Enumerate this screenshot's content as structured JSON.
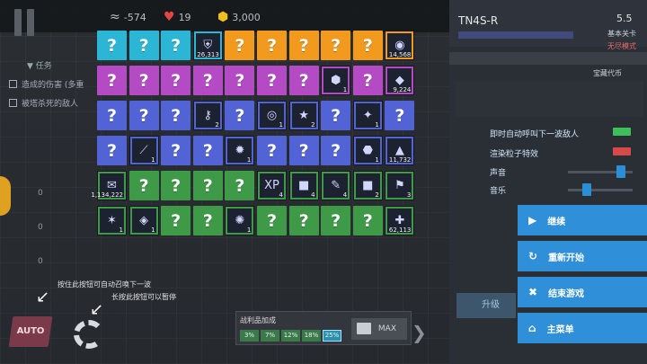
{
  "topbar": {
    "resource1": "-574",
    "hearts": "19",
    "coins": "3,000"
  },
  "mission": {
    "title": "任务",
    "items": [
      "造成的伤害 (多重",
      "被塔杀死的敌人"
    ]
  },
  "slots": [
    {
      "count": "0"
    },
    {
      "count": "0"
    },
    {
      "count": "0"
    }
  ],
  "hints": {
    "auto_summon": "按住此按钮可自动召唤下一波",
    "long_pause": "长按此按钮可以暂停"
  },
  "auto_label": "AUTO",
  "loot": {
    "title": "战利品加成",
    "percentages": [
      "3%",
      "7%",
      "12%",
      "18%",
      "25%"
    ],
    "active_index": 4,
    "max_label": "MAX"
  },
  "grid": {
    "rows": [
      {
        "color": "#2bb6d6",
        "cells": [
          {
            "t": "q"
          },
          {
            "t": "q"
          },
          {
            "t": "q"
          },
          {
            "t": "i",
            "sym": "⛨",
            "cnt": "26,313"
          },
          {
            "t": "q",
            "c": "#f29a1e"
          },
          {
            "t": "q",
            "c": "#f29a1e"
          },
          {
            "t": "q",
            "c": "#f29a1e"
          },
          {
            "t": "q",
            "c": "#f29a1e"
          },
          {
            "t": "q",
            "c": "#f29a1e"
          },
          {
            "t": "i",
            "sym": "◉",
            "cnt": "14,568",
            "c": "#f29a1e"
          }
        ]
      },
      {
        "color": "#b44bc4",
        "cells": [
          {
            "t": "q"
          },
          {
            "t": "q"
          },
          {
            "t": "q"
          },
          {
            "t": "q"
          },
          {
            "t": "q"
          },
          {
            "t": "q"
          },
          {
            "t": "q"
          },
          {
            "t": "i",
            "sym": "⬢",
            "cnt": "1"
          },
          {
            "t": "q"
          },
          {
            "t": "i",
            "sym": "◆",
            "cnt": "9,224"
          }
        ]
      },
      {
        "color": "#5263d6",
        "cells": [
          {
            "t": "q"
          },
          {
            "t": "q"
          },
          {
            "t": "q"
          },
          {
            "t": "i",
            "sym": "⚷",
            "cnt": "2"
          },
          {
            "t": "q"
          },
          {
            "t": "i",
            "sym": "◎",
            "cnt": "1"
          },
          {
            "t": "i",
            "sym": "★",
            "cnt": "2"
          },
          {
            "t": "q"
          },
          {
            "t": "i",
            "sym": "✦",
            "cnt": "1"
          },
          {
            "t": "q"
          }
        ]
      },
      {
        "color": "#5263d6",
        "cells": [
          {
            "t": "q"
          },
          {
            "t": "i",
            "sym": "⟋",
            "cnt": "1"
          },
          {
            "t": "q"
          },
          {
            "t": "q"
          },
          {
            "t": "i",
            "sym": "✹",
            "cnt": "1"
          },
          {
            "t": "q"
          },
          {
            "t": "q"
          },
          {
            "t": "q"
          },
          {
            "t": "i",
            "sym": "⬣",
            "cnt": "1"
          },
          {
            "t": "i",
            "sym": "▲",
            "cnt": "11,732"
          }
        ]
      },
      {
        "color": "#3f9a48",
        "cells": [
          {
            "t": "i",
            "sym": "✉",
            "cnt": "1,134,222"
          },
          {
            "t": "q"
          },
          {
            "t": "q"
          },
          {
            "t": "q"
          },
          {
            "t": "q"
          },
          {
            "t": "i",
            "sym": "XP",
            "cnt": "4"
          },
          {
            "t": "i",
            "sym": "■",
            "cnt": "4"
          },
          {
            "t": "i",
            "sym": "✎",
            "cnt": "4"
          },
          {
            "t": "i",
            "sym": "■",
            "cnt": "2"
          },
          {
            "t": "i",
            "sym": "⚑",
            "cnt": "3"
          }
        ]
      },
      {
        "color": "#3f9a48",
        "cells": [
          {
            "t": "i",
            "sym": "✶",
            "cnt": "1"
          },
          {
            "t": "i",
            "sym": "◈",
            "cnt": "1"
          },
          {
            "t": "q"
          },
          {
            "t": "q"
          },
          {
            "t": "i",
            "sym": "✺",
            "cnt": "1"
          },
          {
            "t": "q"
          },
          {
            "t": "q"
          },
          {
            "t": "q"
          },
          {
            "t": "q"
          },
          {
            "t": "i",
            "sym": "✚",
            "cnt": "62,113"
          }
        ]
      }
    ]
  },
  "sidebar": {
    "level_title": "TN4S-R",
    "version": "5.5",
    "subtitle": "基本关卡",
    "mode": "无尽模式",
    "currency_label": "宝藏代币",
    "auto_next_label": "即时自动呼叫下一波敌人",
    "particles_label": "渲染粒子特效",
    "sound_label": "声音",
    "music_label": "音乐",
    "upgrade_label": "升级"
  },
  "menu": {
    "continue": "继续",
    "restart": "重新开始",
    "end_game": "结束游戏",
    "main_menu": "主菜单"
  }
}
